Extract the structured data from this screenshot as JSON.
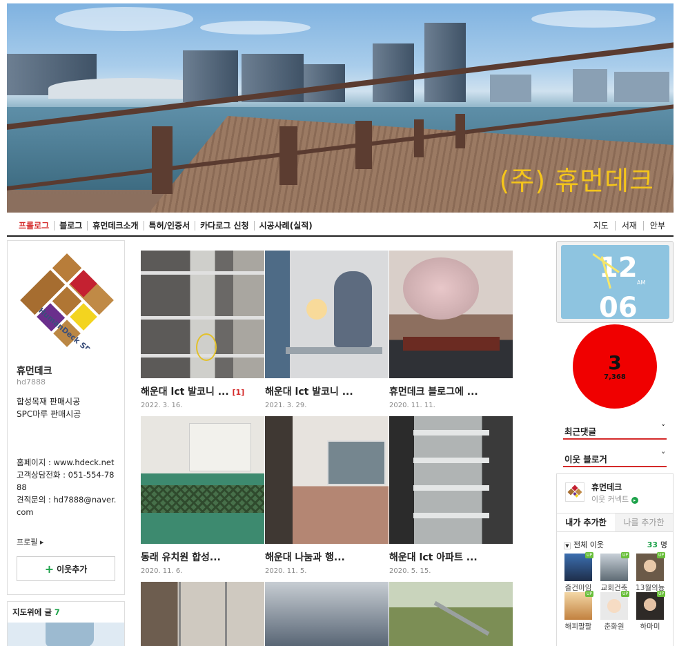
{
  "banner": {
    "title": "(주) 휴먼데크"
  },
  "menu": {
    "left": [
      "프롤로그",
      "블로그",
      "휴먼데크소개",
      "특허/인증서",
      "카다로그 신청",
      "시공사례(실적)"
    ],
    "right": [
      "지도",
      "서재",
      "안부"
    ]
  },
  "profile": {
    "name": "휴먼데크",
    "id": "hd7888",
    "desc1": "합성목재 판매시공",
    "desc2": "SPC마루 판매시공",
    "info1": "홈페이지 : www.hdeck.net",
    "info2": "고객상담전화 : 051-554-7888",
    "info3": "견적문의 : hd7888@naver.com",
    "profile_link": "프로필 ▸",
    "add_neighbor": "이웃추가",
    "add_plus": "+"
  },
  "map_widget": {
    "title": "지도위에 글",
    "count": "7"
  },
  "posts": [
    {
      "title": "해운대 lct 발코니 ...",
      "comments": "[1]",
      "date": "2022. 3. 16."
    },
    {
      "title": "해운대 lct 발코니 ...",
      "comments": "",
      "date": "2021. 3. 29."
    },
    {
      "title": "휴먼데크 블로그에 ...",
      "comments": "",
      "date": "2020. 11. 11."
    },
    {
      "title": "동래 유치원 합성...",
      "comments": "",
      "date": "2020. 11. 6."
    },
    {
      "title": "해운대 나눔과 행...",
      "comments": "",
      "date": "2020. 11. 5."
    },
    {
      "title": "해운대 lct 아파트 ...",
      "comments": "",
      "date": "2020. 5. 15."
    }
  ],
  "clock": {
    "hour": "12",
    "minute": "06",
    "ampm": "AM"
  },
  "counter": {
    "today": "3",
    "total": "7,368"
  },
  "right": {
    "recent_comments": "최근댓글",
    "neighbor_blogger": "이웃 블로거",
    "chevron": "˅"
  },
  "neighbors": {
    "name": "휴먼데크",
    "sub": "이웃 커넥트",
    "tab_mine": "내가 추가한",
    "tab_others": "나를 추가한",
    "all_label": "전체 이웃",
    "count": "33",
    "count_unit": "명",
    "up_label": "UP",
    "items": [
      "즐건마임",
      "교회건축",
      "13월의늉",
      "해피팔팔",
      "춘화원",
      "하마미"
    ]
  }
}
